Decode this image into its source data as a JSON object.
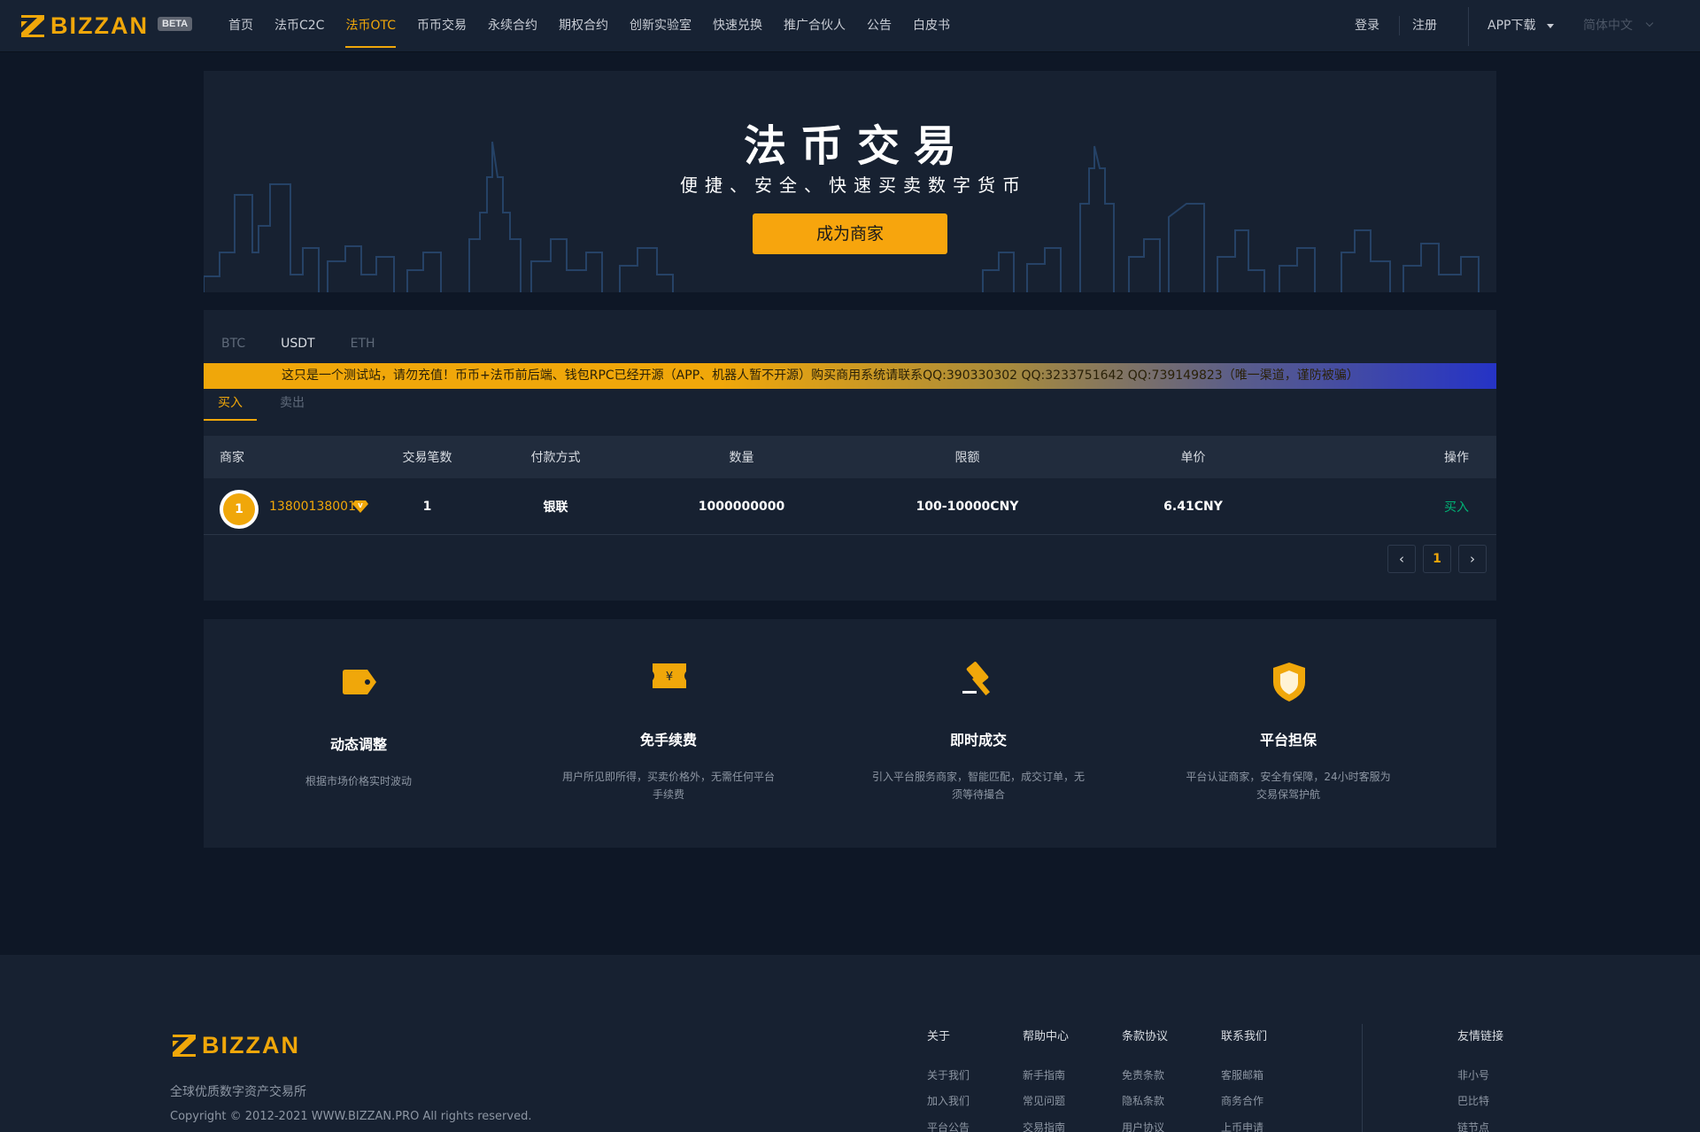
{
  "header": {
    "logo_text": "BIZZAN",
    "beta_label": "BETA",
    "nav": [
      {
        "label": "首页"
      },
      {
        "label": "法币C2C"
      },
      {
        "label": "法币OTC"
      },
      {
        "label": "币币交易"
      },
      {
        "label": "永续合约"
      },
      {
        "label": "期权合约"
      },
      {
        "label": "创新实验室"
      },
      {
        "label": "快速兑换"
      },
      {
        "label": "推广合伙人"
      },
      {
        "label": "公告"
      },
      {
        "label": "白皮书"
      }
    ],
    "active_nav": "法币OTC",
    "login_label": "登录",
    "register_label": "注册",
    "app_download_label": "APP下载",
    "language_label": "简体中文"
  },
  "banner": {
    "title": "法币交易",
    "subtitle": "便捷、安全、快速买卖数字货币",
    "cta_label": "成为商家"
  },
  "trade": {
    "coin_tabs": [
      {
        "label": "BTC"
      },
      {
        "label": "USDT"
      },
      {
        "label": "ETH"
      }
    ],
    "active_coin": "USDT",
    "notice": "这只是一个测试站，请勿充值！币币+法币前后端、钱包RPC已经开源（APP、机器人暂不开源）购买商用系统请联系QQ:390330302 QQ:3233751642 QQ:739149823（唯一渠道，谨防被骗）",
    "direction_tabs": [
      {
        "label": "买入"
      },
      {
        "label": "卖出"
      }
    ],
    "active_direction": "买入",
    "columns": {
      "merchant": "商家",
      "trades": "交易笔数",
      "payment": "付款方式",
      "amount": "数量",
      "limit": "限额",
      "price": "单价",
      "action": "操作"
    },
    "rows": [
      {
        "avatar_initial": "1",
        "merchant": "13800138001",
        "trades": "1",
        "payment": "银联",
        "amount": "1000000000",
        "limit": "100-10000CNY",
        "price": "6.41CNY",
        "action": "买入"
      }
    ],
    "pagination": {
      "prev_icon": "‹",
      "current_page": "1",
      "next_icon": "›"
    }
  },
  "features": [
    {
      "icon": "tag-icon",
      "title": "动态调整",
      "desc": "根据市场价格实时波动"
    },
    {
      "icon": "ticket-icon",
      "title": "免手续费",
      "desc": "用户所见即所得，买卖价格外，无需任何平台手续费"
    },
    {
      "icon": "gavel-icon",
      "title": "即时成交",
      "desc": "引入平台服务商家，智能匹配，成交订单，无须等待撮合"
    },
    {
      "icon": "shield-icon",
      "title": "平台担保",
      "desc": "平台认证商家，安全有保障，24小时客服为交易保驾护航"
    }
  ],
  "footer": {
    "logo_text": "BIZZAN",
    "slogan": "全球优质数字资产交易所",
    "copyright": "Copyright © 2012-2021 WWW.BIZZAN.PRO All rights reserved.",
    "columns": [
      {
        "title": "关于",
        "links": [
          "关于我们",
          "加入我们",
          "平台公告"
        ]
      },
      {
        "title": "帮助中心",
        "links": [
          "新手指南",
          "常见问题",
          "交易指南"
        ]
      },
      {
        "title": "条款协议",
        "links": [
          "免责条款",
          "隐私条款",
          "用户协议"
        ]
      },
      {
        "title": "联系我们",
        "links": [
          "客服邮箱",
          "商务合作",
          "上币申请"
        ]
      },
      {
        "title": "友情链接",
        "links": [
          "非小号",
          "巴比特",
          "链节点"
        ]
      }
    ]
  },
  "colors": {
    "accent": "#f0a70a",
    "buy_green": "#00b275",
    "background": "#0e1726",
    "panel": "#172131"
  }
}
